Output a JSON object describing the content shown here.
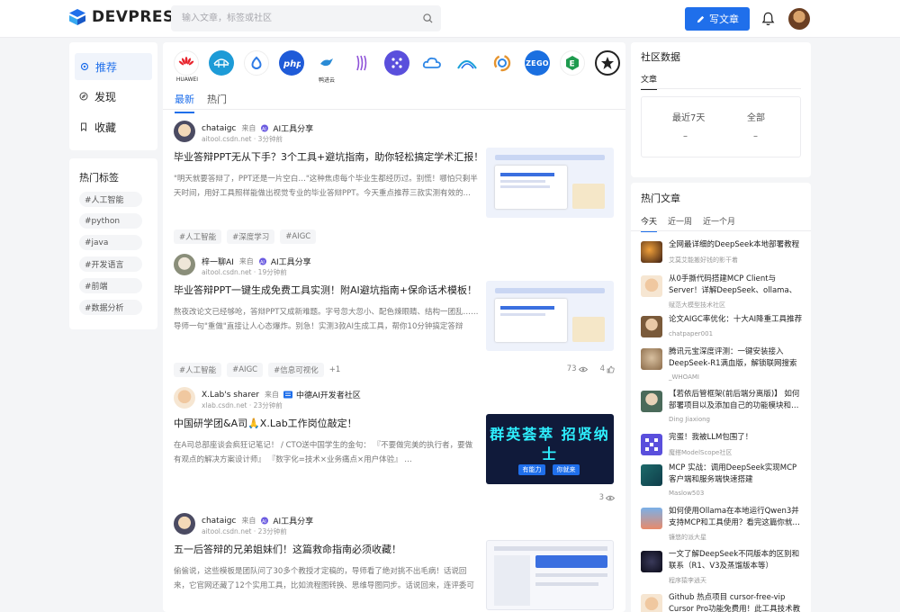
{
  "header": {
    "logo_text": "DEVPRESS",
    "search_placeholder": "输入文章，标签或社区",
    "write_label": "写文章"
  },
  "left_nav": {
    "items": [
      {
        "label": "推荐",
        "icon": "gear-icon",
        "active": true
      },
      {
        "label": "发现",
        "icon": "compass-icon",
        "active": false
      },
      {
        "label": "收藏",
        "icon": "bookmark-icon",
        "active": false
      }
    ]
  },
  "hot_tags": {
    "title": "热门标签",
    "tags": [
      "#人工智能",
      "#python",
      "#java",
      "#开发语言",
      "#前端",
      "#数据分析"
    ]
  },
  "communities": {
    "logos": [
      {
        "name": "huawei-logo",
        "label": "HUAWEI",
        "color": "#e8232c"
      },
      {
        "name": "bridge-logo",
        "label": "",
        "color": "#1d9bd7"
      },
      {
        "name": "droplet-logo",
        "label": "",
        "color": "#2f7be6"
      },
      {
        "name": "php-logo",
        "label": "",
        "color": "#1f5bd8"
      },
      {
        "name": "bird-logo",
        "label": "鸭进云",
        "color": "#2a8bd6"
      },
      {
        "name": "wave-logo",
        "label": "",
        "color": "#8e52d8"
      },
      {
        "name": "grid-logo",
        "label": "",
        "color": "#5a4fdc"
      },
      {
        "name": "cloud-logo",
        "label": "",
        "color": "#2f87e6"
      },
      {
        "name": "arc-logo",
        "label": "",
        "color": "#1aa0d8"
      },
      {
        "name": "ring-logo",
        "label": "",
        "color": "#e6942f"
      },
      {
        "name": "zego-logo",
        "label": "ZEGO",
        "color": "#1a6fe0"
      },
      {
        "name": "e-logo",
        "label": "",
        "color": "#1f9b4f"
      },
      {
        "name": "star-logo",
        "label": "",
        "color": "#222222"
      }
    ]
  },
  "feed": {
    "tabs": [
      "最新",
      "热门"
    ],
    "articles": [
      {
        "author": "chataigc",
        "from": "来自",
        "community": "AI工具分享",
        "domain": "aitool.csdn.net",
        "time": "3分钟前",
        "title": "毕业答辩PPT无从下手？3个工具+避坑指南，助你轻松搞定学术汇报！",
        "summary": "\"明天就要答辩了，PPT还是一片空白…\"这种焦虑每个毕业生都经历过。别慌！哪怕只剩半天时间，用好工具照样能做出视觉专业的毕业答辩PPT。今天重点推荐三款实测有效的…",
        "tags": [
          "#人工智能",
          "#深度学习",
          "#AIGC"
        ],
        "more": "",
        "views": "",
        "likes": ""
      },
      {
        "author": "梓一聊AI",
        "from": "来自",
        "community": "AI工具分享",
        "domain": "aitool.csdn.net",
        "time": "19分钟前",
        "title": "毕业答辩PPT一键生成免费工具实测！附AI避坑指南+保命话术模板！",
        "summary": "熬夜改论文已经够呛，答辩PPT又成新难题。字号忽大忽小、配色辣眼睛、结构一团乱……导师一句\"重做\"直接让人心态爆炸。别急！实测3款AI生成工具，帮你10分钟搞定答辩PPT…",
        "tags": [
          "#人工智能",
          "#AIGC",
          "#信息可视化"
        ],
        "more": "+1",
        "views": "73",
        "likes": "4"
      },
      {
        "author": "X.Lab's sharer",
        "from": "来自",
        "community": "中德AI开发者社区",
        "domain": "xlab.csdn.net",
        "time": "23分钟前",
        "title": "中国研学团&A司🙏X.Lab工作岗位敲定！",
        "summary": "在A司总部座谈会疯狂记笔记！ / CTO送中国学生的金句： 『不要做完美的执行者，要做有观点的解决方案设计师』 『数字化=技术×业务痛点×用户体验』 …",
        "tags": [],
        "more": "",
        "views": "3",
        "likes": "",
        "thumb_title": "群英荟萃 招贤纳士",
        "thumb_btns": [
          "有能力",
          "你就来"
        ]
      },
      {
        "author": "chataigc",
        "from": "来自",
        "community": "AI工具分享",
        "domain": "aitool.csdn.net",
        "time": "23分钟前",
        "title": "五一后答辩的兄弟姐妹们！这篇救命指南必须收藏！",
        "summary": "偷偷说，这些模板是团队问了30多个教授才定稿的，导师看了绝对挑不出毛病！话说回来，它官网还藏了12个实用工具，比如流程图转换、思维导图同步。话说回来，连评委可能问…",
        "tags": [],
        "more": "",
        "views": "",
        "likes": ""
      }
    ]
  },
  "community_data": {
    "title": "社区数据",
    "tab": "文章",
    "cols": [
      {
        "label": "最近7天",
        "value": "–"
      },
      {
        "label": "全部",
        "value": "–"
      }
    ]
  },
  "hot_articles": {
    "title": "热门文章",
    "tabs": [
      "今天",
      "近一周",
      "近一个月"
    ],
    "items": [
      {
        "title": "全网最详细的DeepSeek本地部署教程",
        "author": "艾莫艾能搬好钱的影干着"
      },
      {
        "title": "从0手撕代码搭建MCP Client与Server！详解DeepSeek、ollama、vLLM…",
        "author": "赋范大模型技术社区"
      },
      {
        "title": "论文AIGC率优化：十大AI降重工具推荐",
        "author": "chatpaper001"
      },
      {
        "title": "腾讯元宝深度评测：一键安装接入DeepSeek-R1满血版，解锁联网搜索新体验",
        "author": "_WHOAMI"
      },
      {
        "title": "【若依后管框架(前后端分离版)】 如何部署项目以及添加自己的功能模块和…",
        "author": "Ding Jiaxiong"
      },
      {
        "title": "完蛋！我被LLM包围了！",
        "author": "魔搭ModelScope社区"
      },
      {
        "title": "MCP 实战：调用DeepSeek实现MCP客户端和服务端快速搭建",
        "author": "Maslow503"
      },
      {
        "title": "如何使用Ollama在本地运行Qwen3并支持MCP和工具使用？看完这篇你就…",
        "author": "镰悠的派大星"
      },
      {
        "title": "一文了解DeepSeek不同版本的区别和联系（R1、V3及蒸馏版本等）",
        "author": "程序猿李逍天"
      },
      {
        "title": "Github 热点项目 cursor-free-vip Cursor Pro功能免费用！此工具技术教你…",
        "author": ""
      }
    ]
  }
}
